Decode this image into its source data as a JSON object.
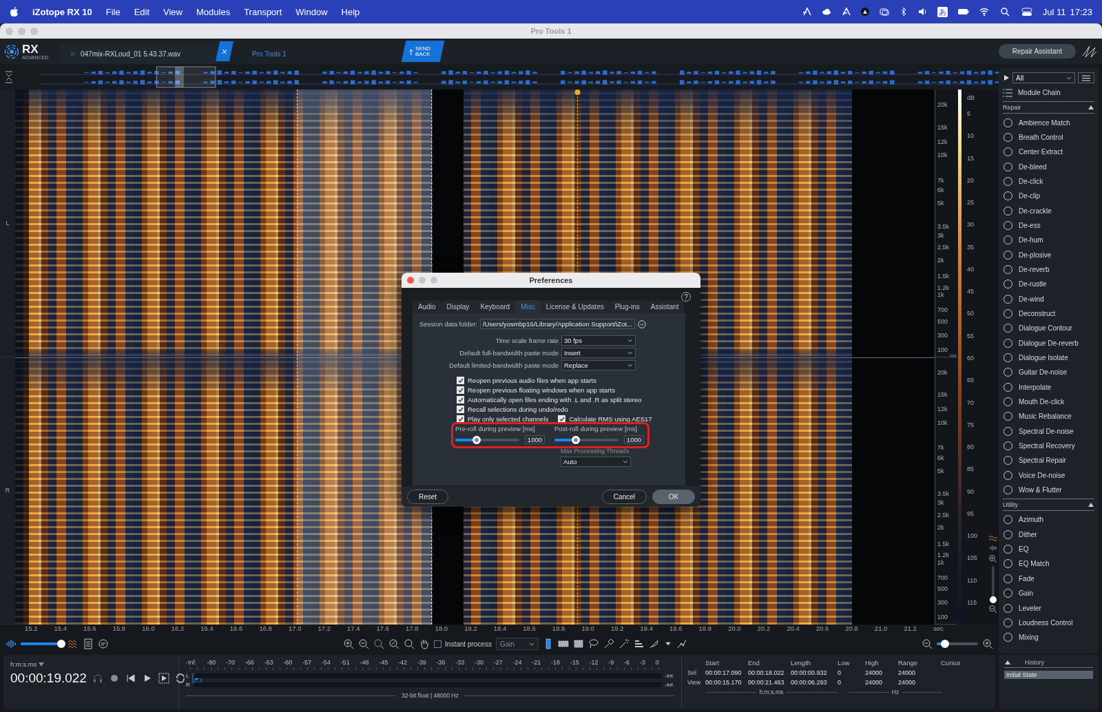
{
  "menu_bar": {
    "app_name": "iZotope RX 10",
    "menus": [
      "File",
      "Edit",
      "View",
      "Modules",
      "Transport",
      "Window",
      "Help"
    ],
    "input_source": "あ",
    "date": "Jul 11",
    "time": "17:23"
  },
  "window": {
    "title": "Pro Tools 1"
  },
  "header": {
    "logo": "RX",
    "logo_sub": "ADVANCED",
    "tabs": [
      {
        "label": "047mix-RXLoud_01 5.43.37.wav",
        "selected": false
      },
      {
        "label": "Pro Tools 1",
        "selected": true
      }
    ],
    "send_back": "SEND BACK",
    "repair_assistant": "Repair Assistant"
  },
  "spectrogram": {
    "channels": [
      {
        "name": "L",
        "freq_ticks": [
          "20k",
          "15k",
          "12k",
          "10k",
          "7k",
          "6k",
          "5k",
          "3.5k",
          "3k",
          "2.5k",
          "2k",
          "1.5k",
          "1.2k",
          "1k",
          "700",
          "500",
          "300",
          "100"
        ],
        "freq_unit": "Hz"
      },
      {
        "name": "R",
        "freq_ticks": [
          "20k",
          "15k",
          "12k",
          "10k",
          "7k",
          "6k",
          "5k",
          "3.5k",
          "3k",
          "2.5k",
          "2k",
          "1.5k",
          "1.2k",
          "1k",
          "700",
          "500",
          "300",
          "100"
        ]
      }
    ],
    "db_unit": "dB",
    "db_ticks": [
      "5",
      "10",
      "15",
      "20",
      "25",
      "30",
      "35",
      "40",
      "45",
      "50",
      "55",
      "60",
      "65",
      "70",
      "75",
      "80",
      "85",
      "90",
      "95",
      "100",
      "105",
      "110",
      "115"
    ],
    "time_ticks": [
      "15.2",
      "15.4",
      "15.6",
      "15.8",
      "16.0",
      "16.2",
      "16.4",
      "16.6",
      "16.8",
      "17.0",
      "17.2",
      "17.4",
      "17.6",
      "17.8",
      "18.0",
      "18.2",
      "18.4",
      "18.6",
      "18.8",
      "19.0",
      "19.2",
      "19.4",
      "19.6",
      "19.8",
      "20.0",
      "20.2",
      "20.4",
      "20.6",
      "20.8",
      "21.0",
      "21.2"
    ],
    "time_unit": "sec",
    "vertical_zoom": {
      "level": 0.05
    }
  },
  "toolbar": {
    "waveform_blend": {
      "level": 0.95
    },
    "instant_process": {
      "label": "Instant process",
      "checked": false
    },
    "process_mode": "Gain",
    "zoom": {
      "level": 0.2
    }
  },
  "modules": {
    "filter": "All",
    "chain": "Module Chain",
    "groups": [
      {
        "name": "Repair",
        "expanded": true,
        "items": [
          "Ambience Match",
          "Breath Control",
          "Center Extract",
          "De-bleed",
          "De-click",
          "De-clip",
          "De-crackle",
          "De-ess",
          "De-hum",
          "De-plosive",
          "De-reverb",
          "De-rustle",
          "De-wind",
          "Deconstruct",
          "Dialogue Contour",
          "Dialogue De-reverb",
          "Dialogue Isolate",
          "Guitar De-noise",
          "Interpolate",
          "Mouth De-click",
          "Music Rebalance",
          "Spectral De-noise",
          "Spectral Recovery",
          "Spectral Repair",
          "Voice De-noise",
          "Wow & Flutter"
        ]
      },
      {
        "name": "Utility",
        "expanded": true,
        "items": [
          "Azimuth",
          "Dither",
          "EQ",
          "EQ Match",
          "Fade",
          "Gain",
          "Leveler",
          "Loudness Control",
          "Mixing"
        ]
      }
    ]
  },
  "transport": {
    "time_format": "h:m:s.ms",
    "time": "00:00:19.022"
  },
  "meter": {
    "scale": [
      "-Inf.",
      "-80",
      "-70",
      "-66",
      "-63",
      "-60",
      "-57",
      "-54",
      "-51",
      "-48",
      "-45",
      "-42",
      "-39",
      "-36",
      "-33",
      "-30",
      "-27",
      "-24",
      "-21",
      "-18",
      "-15",
      "-12",
      "-9",
      "-6",
      "-3",
      "0"
    ],
    "channels": [
      {
        "name": "L",
        "peak": "-Inf."
      },
      {
        "name": "R",
        "peak": "-Inf."
      }
    ],
    "format": "32-bit float | 48000 Hz"
  },
  "selection_info": {
    "columns": [
      "Start",
      "End",
      "Length",
      "Low",
      "High",
      "Range"
    ],
    "cursor": "Cursor",
    "rows": [
      {
        "label": "Sel",
        "values": [
          "00:00:17.090",
          "00:00:18.022",
          "00:00:00.932",
          "0",
          "24000",
          "24000"
        ]
      },
      {
        "label": "View",
        "values": [
          "00:00:15.170",
          "00:00:21.463",
          "00:00:06.293",
          "0",
          "24000",
          "24000"
        ]
      }
    ],
    "time_unit": "h:m:s.ms",
    "freq_unit": "Hz"
  },
  "history": {
    "title": "History",
    "items": [
      {
        "label": "Initial State",
        "selected": true
      }
    ]
  },
  "dialog": {
    "title": "Preferences",
    "help": "?",
    "tabs": [
      {
        "label": "Audio",
        "selected": false
      },
      {
        "label": "Display",
        "selected": false
      },
      {
        "label": "Keyboard",
        "selected": false
      },
      {
        "label": "Misc",
        "selected": true
      },
      {
        "label": "License & Updates",
        "selected": false
      },
      {
        "label": "Plug-ins",
        "selected": false
      },
      {
        "label": "Assistant",
        "selected": false
      }
    ],
    "session_folder": {
      "label": "Session data folder:",
      "value": "/Users/yosmbp16/Library/Application Support/iZot..."
    },
    "dropdowns": [
      {
        "label": "Time scale frame rate",
        "value": "30 fps"
      },
      {
        "label": "Default full-bandwidth paste mode",
        "value": "Insert"
      },
      {
        "label": "Default limited-bandwidth paste mode",
        "value": "Replace"
      }
    ],
    "checkboxes": [
      {
        "label": "Reopen previous audio files when app starts",
        "checked": true
      },
      {
        "label": "Reopen previous floating windows when app starts",
        "checked": true
      },
      {
        "label": "Automatically open files ending with .L and .R as split stereo",
        "checked": true
      },
      {
        "label": "Recall selections during undo/redo",
        "checked": true
      },
      {
        "label": "Play only selected channels",
        "checked": true
      },
      {
        "label": "Calculate RMS using AES17",
        "checked": true
      }
    ],
    "sliders": [
      {
        "label": "Pre-roll during preview [ms]",
        "level": 0.33,
        "value": "1000"
      },
      {
        "label": "Post-roll during preview [ms]",
        "level": 0.33,
        "value": "1000"
      }
    ],
    "threads": {
      "label": "Max Processing Threads",
      "value": "Auto"
    },
    "buttons": [
      {
        "label": "Reset",
        "kind": "secondary"
      },
      {
        "label": "Cancel",
        "kind": "secondary"
      },
      {
        "label": "OK",
        "kind": "primary"
      }
    ]
  }
}
